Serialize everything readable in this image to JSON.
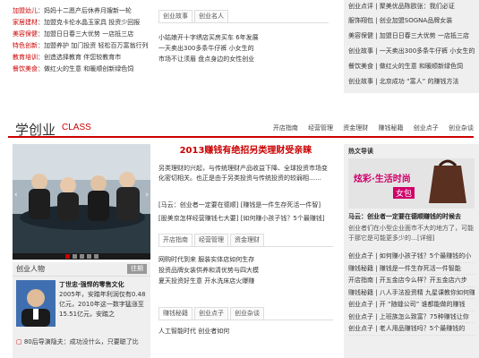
{
  "top_left": [
    {
      "tag": "加盟幼儿",
      "text": "：妈妈十二愿产后休养月嫂新一轮"
    },
    {
      "tag": "家居建材",
      "text": "：加盟克卡伦水晶玉家具 投资少回报"
    },
    {
      "tag": "美容保健",
      "text": "：加盟日日春三大优势 一店抵三店"
    },
    {
      "tag": "特色创新",
      "text": "：加盟养护 加门投资 轻松百万富翁行列"
    },
    {
      "tag": "教育培训",
      "text": "：创造选择教育 伴您较教育市"
    },
    {
      "tag": "餐饮美食",
      "text": "：做红火的生意 和暖顺创新绿色饲"
    }
  ],
  "top_center": {
    "tabs": [
      "创业故事",
      "创业名人"
    ],
    "lines": [
      "小姑娘开十字绣店买房买车 6年发展",
      "一天卖出300多条牛仔裤 小女生的",
      "市场不让须眉 盘点身边的女性创业"
    ]
  },
  "top_right": [
    "创业点评 | 聚美优品陈欧张：我们必证",
    "服饰翔包 | 创业加盟SOGNA品牌女装",
    "美容保健 | 加盟日日春三大优势 一店抵三店",
    "创业故事 | 一天卖出300多条牛仔裤 小女生的",
    "餐饮美食 | 做红火的生意 和暖顺新绿色饲",
    "创业故事 | 北京成功 “富人” 的赚钱方法"
  ],
  "section": {
    "title": "学创业",
    "subtitle": "CLASS",
    "nav": [
      "开店指南",
      "经营管理",
      "资金理财",
      "赚钱秘籍",
      "创业点子",
      "创业杂谈"
    ]
  },
  "mid_center": {
    "headline": "2013赚钱有绝招另类理财受亲睐",
    "intro": "另类理财的兴起，与传统理财产品收益下降、全球投资市场变化密切相关。也正是由于另类投资与传统投资的较弱相……",
    "links": [
      [
        "[马云：创业者一定要在德顺]",
        "[赚钱是一件生存死活一件智]"
      ],
      [
        "[股美京怎样经营赚钱七大要]",
        "[如何赚小孩子钱？5个最赚钱]"
      ]
    ],
    "tabs": [
      "开店指南",
      "经营管理",
      "资金理财"
    ],
    "list1": [
      "网购时代到来 服装实体店如何生存",
      "投资品牌女装供养和清优势与四大模",
      "夏天投资好生意 开水洗床店火爆赚"
    ],
    "tabs2": [
      "赚钱秘籍",
      "创业点子",
      "创业杂谈"
    ],
    "list2": [
      "人工智能时代 创业者如何"
    ]
  },
  "hot": {
    "title": "热文导读",
    "banner1": "炫彩·生活时尚",
    "banner2": "女包",
    "caption": "马云：创业者一定要在德顺赚钱的时候去",
    "desc": "创业者们在小型企业面市不大的地方了，可能于那它是可能更多少的…[详细]"
  },
  "mid_right_list": [
    "创业点子 | 如何赚小孩子钱？5个最赚钱的小",
    "赚钱秘籍 | 赚钱是一件生存死活一件智能",
    "开店指南 | 开五金店今么样？开五金店六步",
    "赚钱秘籍 | 八人手法投资精 九星课教你如何赚钱",
    "创业点子 | 开 “随缝公司” 谁都能做的赚钱",
    "创业点子 | 上班族怎么致富？75种赚钱让你",
    "创业点子 | 老人用品赚钱吗？5个最赚钱的"
  ],
  "person": {
    "header": "创业人物",
    "more": "往期",
    "name": "丁世忠·强悍的零售文化",
    "bio": "2005年，安踏年利润仅有0.48亿元，2010年这一数字猛涨至15.51亿元，安踏之",
    "bottom": "80后导演隐夫：成功没什么，只要聪了比"
  },
  "slider": {
    "dots": 5
  }
}
